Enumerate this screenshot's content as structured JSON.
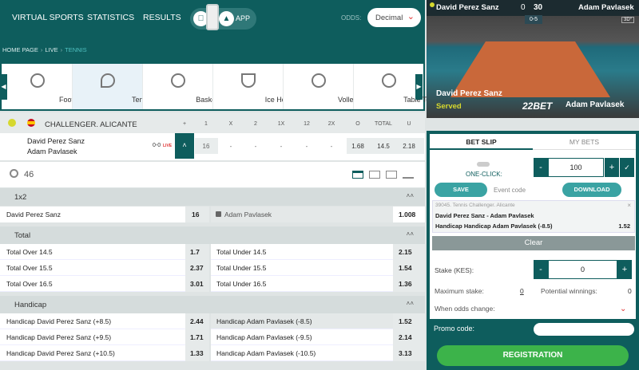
{
  "nav": {
    "virtual_sports": "VIRTUAL SPORTS",
    "statistics": "STATISTICS",
    "results": "RESULTS",
    "app": "APP",
    "odds_label": "ODDS:",
    "odds_value": "Decimal"
  },
  "breadcrumb": {
    "home": "HOME PAGE",
    "live": "LIVE",
    "tennis": "TENNIS"
  },
  "sports": [
    {
      "label": "Football"
    },
    {
      "label": "Tennis"
    },
    {
      "label": "Basketball"
    },
    {
      "label": "Ice Hockey"
    },
    {
      "label": "Volleyball"
    },
    {
      "label": "Table Tennis"
    }
  ],
  "match": {
    "league": "CHALLENGER. ALICANTE",
    "headers": [
      "+",
      "1",
      "X",
      "2",
      "1X",
      "12",
      "2X",
      "O",
      "TOTAL",
      "U"
    ],
    "player1": "David Perez Sanz",
    "player2": "Adam Pavlasek",
    "score": "0-0",
    "live": "LIVE",
    "values": [
      "16",
      "-",
      "-",
      "-",
      "-",
      "-",
      "-",
      "1.68",
      "14.5",
      "2.18"
    ]
  },
  "markets_count": "46",
  "markets": {
    "onex2": {
      "title": "1x2",
      "rows": [
        {
          "a": "David Perez Sanz",
          "ao": "16",
          "b": "Adam Pavlasek",
          "bo": "1.008"
        }
      ]
    },
    "total": {
      "title": "Total",
      "rows": [
        {
          "a": "Total Over 14.5",
          "ao": "1.7",
          "b": "Total Under 14.5",
          "bo": "2.15"
        },
        {
          "a": "Total Over 15.5",
          "ao": "2.37",
          "b": "Total Under 15.5",
          "bo": "1.54"
        },
        {
          "a": "Total Over 16.5",
          "ao": "3.01",
          "b": "Total Under 16.5",
          "bo": "1.36"
        }
      ]
    },
    "handicap": {
      "title": "Handicap",
      "rows": [
        {
          "a": "Handicap David Perez Sanz (+8.5)",
          "ao": "2.44",
          "b": "Handicap Adam Pavlasek (-8.5)",
          "bo": "1.52"
        },
        {
          "a": "Handicap David Perez Sanz (+9.5)",
          "ao": "1.71",
          "b": "Handicap Adam Pavlasek (-9.5)",
          "bo": "2.14"
        },
        {
          "a": "Handicap David Perez Sanz (+10.5)",
          "ao": "1.33",
          "b": "Handicap Adam Pavlasek (-10.5)",
          "bo": "3.13"
        }
      ]
    }
  },
  "video": {
    "p1": "David Perez Sanz",
    "p2": "Adam Pavlasek",
    "sets": "0",
    "points": "30",
    "games": "0-5",
    "badge": "3D°",
    "served": "Served",
    "brand": "22BET"
  },
  "betslip": {
    "tab_betslip": "BET SLIP",
    "tab_mybets": "MY BETS",
    "one_click": "ONE-CLICK:",
    "one_click_value": "100",
    "save": "SAVE",
    "event_code": "Event code",
    "download": "DOWNLOAD",
    "bet": {
      "event": "39045. Tennis Challenger. Alicante",
      "match": "David Perez Sanz - Adam Pavlasek",
      "selection": "Handicap Handicap Adam Pavlasek (-8.5)",
      "odds": "1.52"
    },
    "clear": "Clear",
    "stake_label": "Stake (KES):",
    "stake_value": "0",
    "max_stake_label": "Maximum stake:",
    "max_stake_value": "0",
    "potential_label": "Potential winnings:",
    "potential_value": "0",
    "odds_change_label": "When odds change:",
    "promo_label": "Promo code:",
    "registration": "REGISTRATION"
  },
  "colors": {
    "primary": "#0e5d5d",
    "accent": "#3aa3a3",
    "green": "#3cb34a",
    "red": "#e03030"
  }
}
